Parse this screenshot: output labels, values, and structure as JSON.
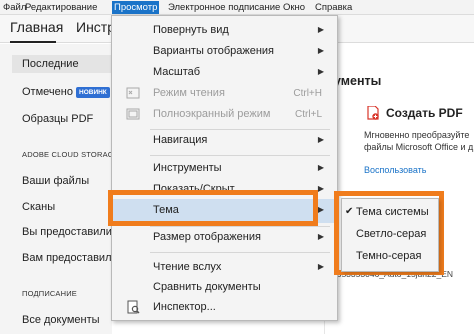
{
  "menubar": {
    "items": [
      "Файл",
      "Редактирование",
      "Просмотр",
      "Электронное подписание",
      "Окно",
      "Справка"
    ]
  },
  "tabs": {
    "home": "Главная",
    "tools": "Инстру"
  },
  "left_pane": {
    "recent": "Последние",
    "starred": "Отмечено",
    "new_badge": "НОВИНК",
    "samples": "Образцы PDF",
    "cloud_section": "ADOBE CLOUD STORAG",
    "your_files": "Ваши файлы",
    "scans": "Сканы",
    "shared_by_you": "Вы предоставили д",
    "shared_with_you": "Вам предоставил",
    "signatures_section": "ПОДПИСАНИЕ",
    "all_documents": "Все документы"
  },
  "content": {
    "heading": "ументы",
    "create_pdf": "Создать PDF",
    "desc_line1": "Мгновенно преобразуйте",
    "desc_line2": "файлы Microsoft Office и д",
    "use_link": "Воспользовать",
    "filename": "1653353046_Auto_15jun22_EN"
  },
  "view_menu": {
    "items": [
      {
        "label": "Повернуть вид",
        "submenu": true,
        "disabled": false
      },
      {
        "label": "Варианты отображения",
        "submenu": true,
        "disabled": false
      },
      {
        "label": "Масштаб",
        "submenu": true,
        "disabled": false
      },
      {
        "label": "Режим чтения",
        "shortcut": "Ctrl+H",
        "disabled": true
      },
      {
        "label": "Полноэкранный режим",
        "shortcut": "Ctrl+L",
        "disabled": true
      },
      {
        "label": "Навигация",
        "submenu": true,
        "disabled": false
      },
      {
        "label": "Инструменты",
        "submenu": true,
        "disabled": false
      },
      {
        "label": "Показать/Скрыт",
        "submenu": true,
        "disabled": false
      },
      {
        "label": "Тема",
        "submenu": true,
        "disabled": false,
        "highlighted": true
      },
      {
        "label": "Размер отображения",
        "submenu": true,
        "disabled": false
      },
      {
        "label": "Чтение вслух",
        "submenu": true,
        "disabled": false
      },
      {
        "label": "Сравнить документы",
        "disabled": false
      },
      {
        "label": "Инспектор...",
        "disabled": false
      }
    ]
  },
  "theme_submenu": {
    "items": [
      {
        "label": "Тема системы",
        "checked": true
      },
      {
        "label": "Светло-серая",
        "checked": false
      },
      {
        "label": "Темно-серая",
        "checked": false
      }
    ]
  },
  "colors": {
    "accent": "#1a73c8",
    "highlight_box": "#f07c1c",
    "menu_bg": "#f4f4f4",
    "menu_hover": "#cfdff0",
    "badge": "#2f6fd3",
    "pdf_red": "#d8352a"
  },
  "icons": {
    "submenu_arrow": "chevron-right-icon",
    "check": "checkmark-icon",
    "reading_mode": "reading-mode-icon",
    "fullscreen": "fullscreen-icon",
    "inspector": "inspector-icon",
    "create_pdf": "create-pdf-icon"
  }
}
